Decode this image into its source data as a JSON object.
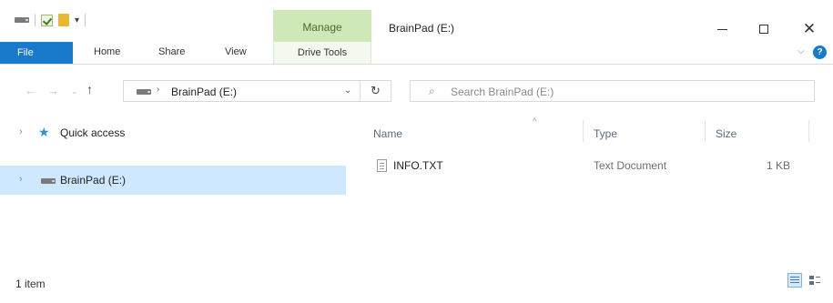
{
  "window": {
    "title": "BrainPad (E:)",
    "minimize": "—",
    "close": "✕"
  },
  "quick_access_toolbar": {
    "dropdown": "▾"
  },
  "contextual_tab": {
    "label": "Manage",
    "color": "#cfe8b8"
  },
  "ribbon": {
    "tabs": [
      "File",
      "Home",
      "Share",
      "View"
    ],
    "contextual": "Drive Tools",
    "file_color": "#1979ca",
    "expand": "⌵",
    "help": "?"
  },
  "address_bar": {
    "back": "←",
    "forward": "→",
    "recent": "⌄",
    "up": "↑",
    "separator": "›",
    "path": "BrainPad (E:)",
    "dropdown": "⌄",
    "refresh": "↻"
  },
  "search": {
    "icon": "⌕",
    "placeholder": "Search BrainPad (E:)"
  },
  "navigation_pane": {
    "items": [
      {
        "label": "Quick access",
        "chevron": "›",
        "icon": "★"
      },
      {
        "label": "BrainPad (E:)",
        "chevron": "›",
        "selected": true
      }
    ],
    "selected_color": "#cde8ff"
  },
  "file_list": {
    "sort_indicator": "^",
    "columns": [
      "Name",
      "Type",
      "Size"
    ],
    "rows": [
      {
        "name": "INFO.TXT",
        "type": "Text Document",
        "size": "1 KB"
      }
    ]
  },
  "status_bar": {
    "item_count": "1 item"
  }
}
